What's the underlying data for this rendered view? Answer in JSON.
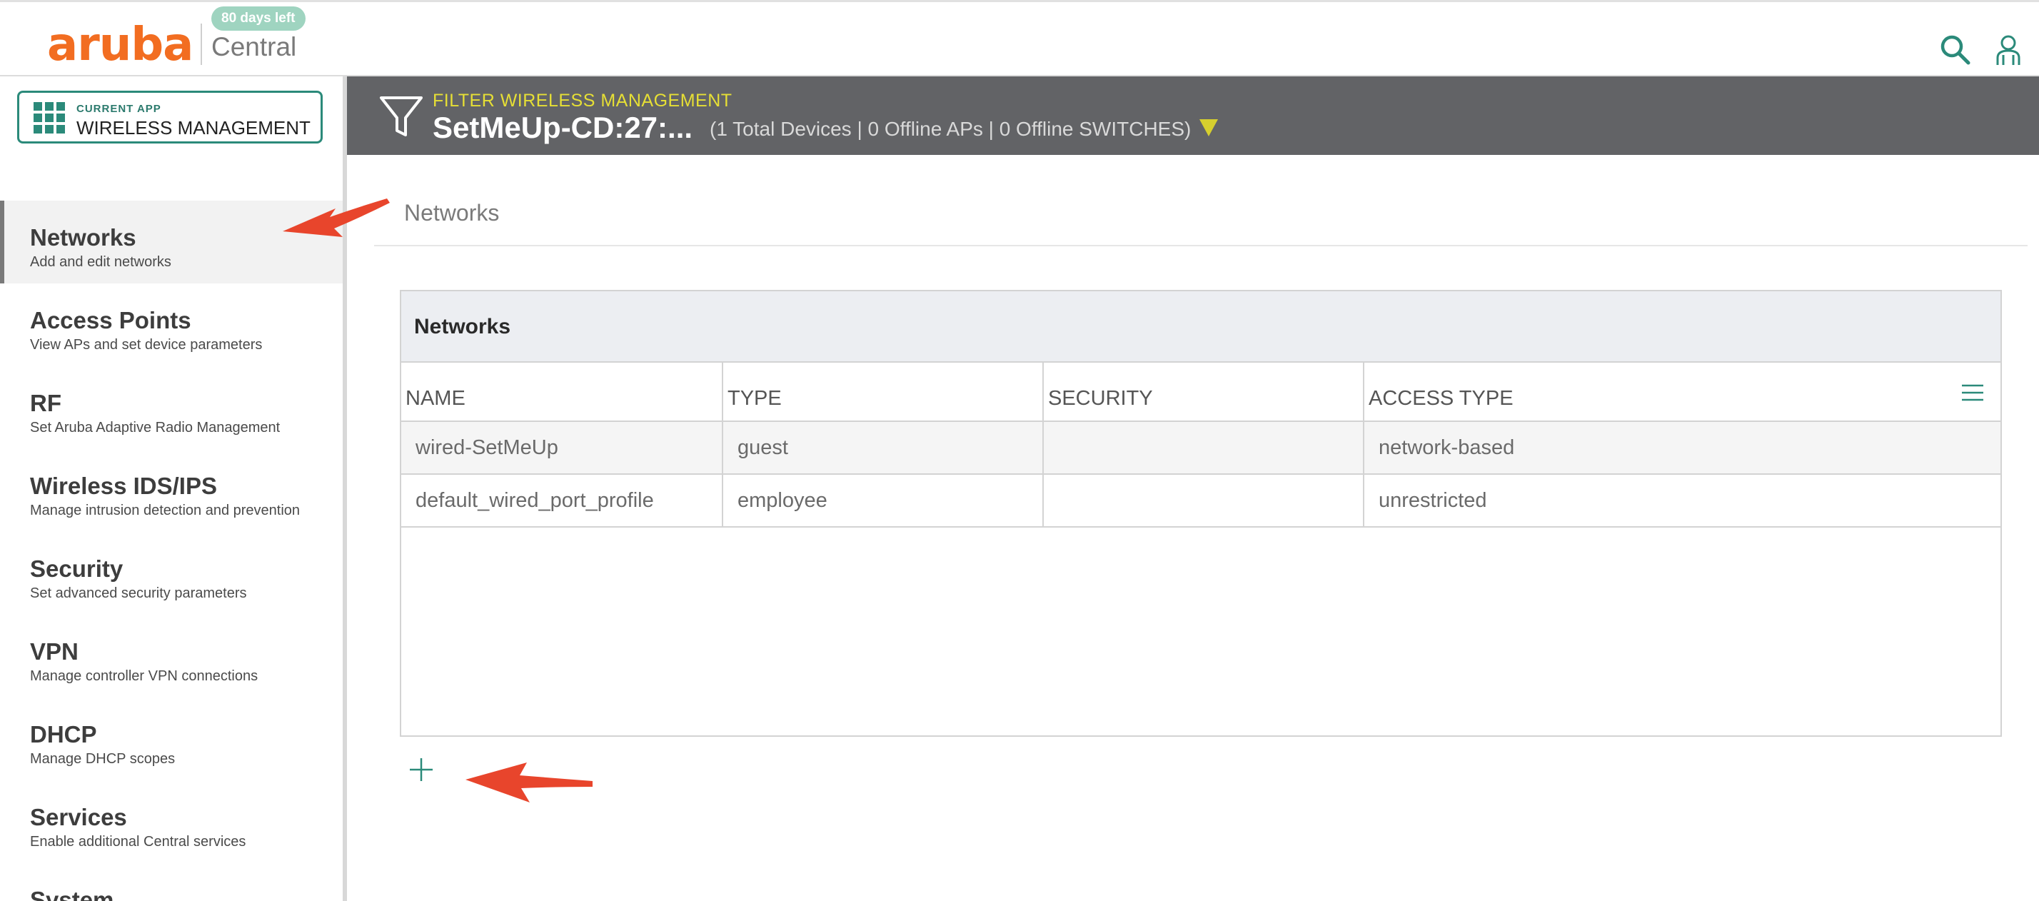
{
  "header": {
    "brand": "aruba",
    "product": "Central",
    "trial_badge": "80 days left",
    "icons": {
      "search": "search-icon",
      "user": "user-icon"
    }
  },
  "current_app": {
    "caption": "CURRENT APP",
    "name": "WIRELESS MANAGEMENT"
  },
  "sidebar": {
    "items": [
      {
        "title": "Networks",
        "subtitle": "Add and edit networks",
        "active": true
      },
      {
        "title": "Access Points",
        "subtitle": "View APs and set device parameters"
      },
      {
        "title": "RF",
        "subtitle": "Set Aruba Adaptive Radio Management"
      },
      {
        "title": "Wireless IDS/IPS",
        "subtitle": "Manage intrusion detection and prevention"
      },
      {
        "title": "Security",
        "subtitle": "Set advanced security parameters"
      },
      {
        "title": "VPN",
        "subtitle": "Manage controller VPN connections"
      },
      {
        "title": "DHCP",
        "subtitle": "Manage DHCP scopes"
      },
      {
        "title": "Services",
        "subtitle": "Enable additional Central services"
      },
      {
        "title": "System",
        "subtitle": ""
      }
    ]
  },
  "filter": {
    "caption": "FILTER WIRELESS MANAGEMENT",
    "device": "SetMeUp-CD:27:...",
    "stats": "(1 Total Devices | 0 Offline APs | 0 Offline SWITCHES)"
  },
  "main": {
    "title": "Networks",
    "panel_title": "Networks",
    "columns": [
      "NAME",
      "TYPE",
      "SECURITY",
      "ACCESS TYPE"
    ],
    "rows": [
      {
        "name": "wired-SetMeUp",
        "type": "guest",
        "security": "",
        "access_type": "network-based"
      },
      {
        "name": "default_wired_port_profile",
        "type": "employee",
        "security": "",
        "access_type": "unrestricted"
      }
    ]
  },
  "colors": {
    "brand_orange": "#f26d21",
    "accent_teal": "#2b8a7a",
    "filter_bar": "#626366",
    "filter_caption": "#e6df35",
    "annotation_arrow": "#e8452c"
  }
}
